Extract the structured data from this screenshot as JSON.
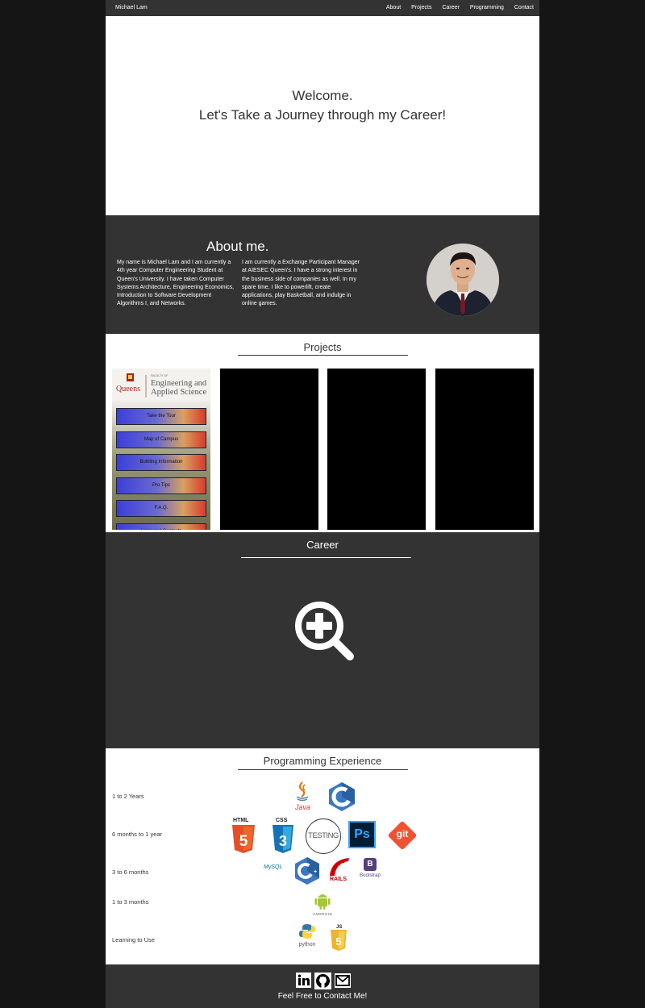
{
  "nav": {
    "brand": "Michael Lam",
    "links": [
      "About",
      "Projects",
      "Career",
      "Programming",
      "Contact"
    ]
  },
  "hero": {
    "line1": "Welcome.",
    "line2": "Let's Take a Journey through my Career!"
  },
  "about": {
    "title": "About me.",
    "col1": "My name is Michael Lam and I am currently a 4th year Computer Engineering Student at Queen's University. I have taken Computer Systems Architecture, Engineering Economics, Introduction to Software Development Algorithms I, and Networks.",
    "col2": "I am currently a Exchange Participant Manager at AIESEC Queen's. I have a strong interest in the business side of companies as well. In my spare time, I like to powerlift, create applications, play Basketball, and indulge in online games."
  },
  "projects": {
    "title": "Projects",
    "app": {
      "brand_small": "FACULTY OF",
      "brand_line1": "Engineering and",
      "brand_line2": "Applied Science",
      "logo_text": "Queens",
      "buttons": [
        "Take the Tour",
        "Map of Campus",
        "Building Information",
        "Pro Tips",
        "F.A.Q.",
        "Links and Contacts"
      ]
    }
  },
  "career": {
    "title": "Career",
    "icon": "zoom-in-icon"
  },
  "programming": {
    "title": "Programming Experience",
    "levels": [
      "1 to 2 Years",
      "6 months to 1 year",
      "3 to 6 months",
      "1 to 3 months",
      "Learning to Use"
    ],
    "logos": {
      "java": "Java",
      "html": "HTML",
      "css": "CSS",
      "testing": "TESTING",
      "ps": "Ps",
      "git": "git",
      "mysql": "MySQL",
      "rails": "RAILS",
      "bootstrap": "Bootstrap",
      "bootstrap_letter": "B",
      "android": "ANDROID",
      "python": "python",
      "js": "JS"
    }
  },
  "footer": {
    "message": "Feel Free to Contact Me!",
    "icons": [
      "linkedin-icon",
      "github-icon",
      "email-icon"
    ]
  },
  "colors": {
    "dark": "#333333",
    "background": "#151515"
  }
}
